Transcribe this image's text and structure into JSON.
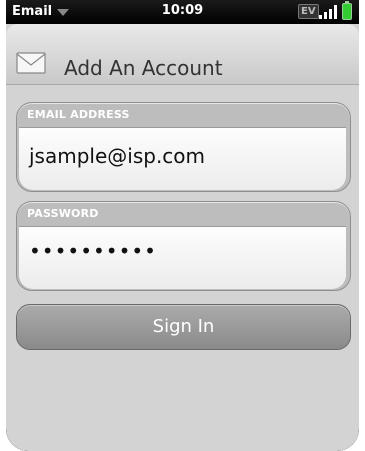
{
  "status_bar": {
    "app_name": "Email",
    "time": "10:09",
    "network": "EV"
  },
  "header": {
    "title": "Add An Account",
    "icon": "mail-icon"
  },
  "form": {
    "email_label": "EMAIL ADDRESS",
    "email_value": "jsample@isp.com",
    "password_label": "PASSWORD",
    "password_value": "••••••••••"
  },
  "actions": {
    "sign_in_label": "Sign In"
  }
}
